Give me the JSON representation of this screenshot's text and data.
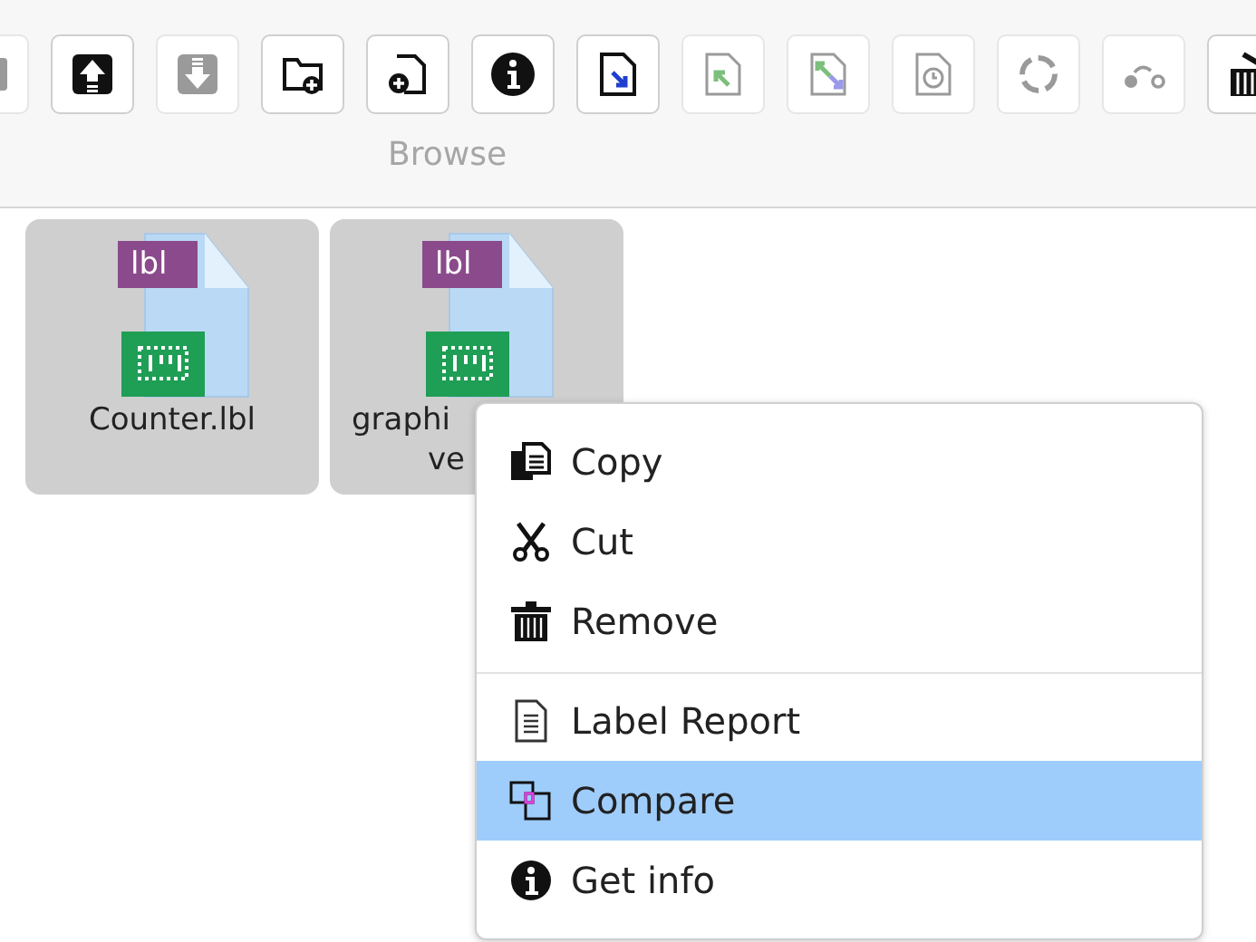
{
  "toolbar": {
    "buttons": [
      {
        "kind": "partial",
        "disabled": true
      },
      {
        "kind": "upload",
        "disabled": false
      },
      {
        "kind": "download",
        "disabled": true
      },
      {
        "kind": "new-folder",
        "disabled": false
      },
      {
        "kind": "new-file",
        "disabled": false
      },
      {
        "kind": "info",
        "disabled": false
      },
      {
        "kind": "import",
        "disabled": false
      },
      {
        "kind": "export",
        "disabled": true
      },
      {
        "kind": "swap",
        "disabled": true
      },
      {
        "kind": "history",
        "disabled": true
      },
      {
        "kind": "refresh",
        "disabled": true
      },
      {
        "kind": "connect",
        "disabled": true
      },
      {
        "kind": "trash",
        "disabled": false
      }
    ],
    "group_label": "Browse"
  },
  "files": [
    {
      "badge": "lbl",
      "name_lines": [
        "Counter.lbl"
      ],
      "selected": true
    },
    {
      "badge": "lbl",
      "name_lines": [
        "graphi",
        "ve"
      ],
      "selected": true
    }
  ],
  "context_menu": {
    "sections": [
      [
        {
          "kind": "copy",
          "label": "Copy",
          "selected": false
        },
        {
          "kind": "cut",
          "label": "Cut",
          "selected": false
        },
        {
          "kind": "remove",
          "label": "Remove",
          "selected": false
        }
      ],
      [
        {
          "kind": "report",
          "label": "Label Report",
          "selected": false
        },
        {
          "kind": "compare",
          "label": "Compare",
          "selected": true
        },
        {
          "kind": "info",
          "label": "Get info",
          "selected": false
        }
      ]
    ]
  }
}
